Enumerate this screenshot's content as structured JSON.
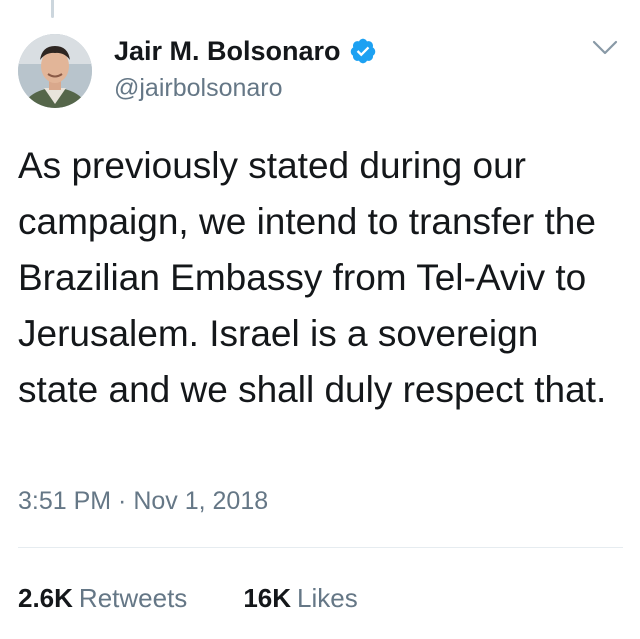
{
  "tweet": {
    "author": {
      "display_name": "Jair M. Bolsonaro",
      "handle": "@jairbolsonaro",
      "verified": true,
      "avatar_icon": "user-avatar"
    },
    "text": "As previously stated during our campaign, we intend to transfer the Brazilian Embassy from Tel-Aviv to Jerusalem. Israel is a sovereign state and we shall duly respect that.",
    "timestamp": "3:51 PM · Nov 1, 2018",
    "stats": {
      "retweets_count": "2.6K",
      "retweets_label": "Retweets",
      "likes_count": "16K",
      "likes_label": "Likes"
    }
  },
  "colors": {
    "verified_badge": "#1da1f2",
    "secondary_text": "#657786",
    "primary_text": "#14171a",
    "divider": "#e6ecf0"
  },
  "icons": {
    "verified": "verified-badge-icon",
    "menu": "chevron-down-icon"
  }
}
